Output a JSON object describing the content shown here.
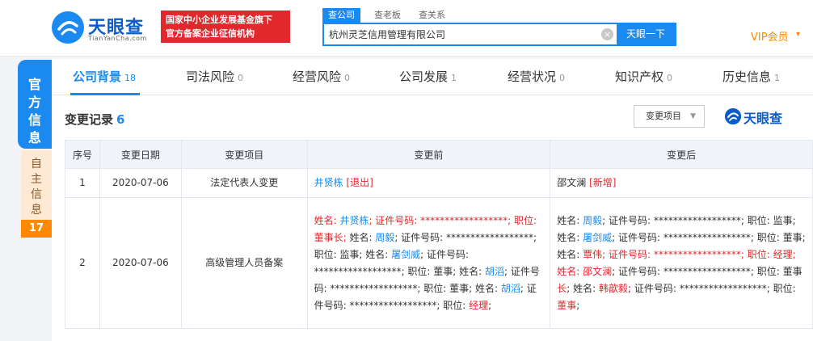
{
  "header": {
    "logo_text": "天眼查",
    "logo_sub": "TianYanCha.com",
    "badge_line1": "国家中小企业发展基金旗下",
    "badge_line2": "官方备案企业征信机构",
    "search_tabs": [
      "查公司",
      "查老板",
      "查关系"
    ],
    "search_value": "杭州灵芝信用管理有限公司",
    "clear_icon": "×",
    "search_button": "天眼一下",
    "vip_label": "VIP会员",
    "vip_arrow": "▾"
  },
  "sidebar": {
    "official_label": "官方信息",
    "self_label": "自主信息",
    "self_count": "17"
  },
  "tabs": [
    {
      "label": "公司背景",
      "count": "18"
    },
    {
      "label": "司法风险",
      "count": "0"
    },
    {
      "label": "经营风险",
      "count": "0"
    },
    {
      "label": "公司发展",
      "count": "1"
    },
    {
      "label": "经营状况",
      "count": "0"
    },
    {
      "label": "知识产权",
      "count": "0"
    },
    {
      "label": "历史信息",
      "count": "1"
    }
  ],
  "section": {
    "title": "变更记录",
    "count": "6",
    "filter_label": "变更项目",
    "filter_caret": "▼",
    "watermark": "天眼查"
  },
  "table": {
    "headers": [
      "序号",
      "变更日期",
      "变更项目",
      "变更前",
      "变更后"
    ],
    "rows": [
      {
        "index": "1",
        "date": "2020-07-06",
        "item": "法定代表人变更",
        "before": [
          {
            "t": "井贤栋",
            "c": "blue"
          },
          {
            "t": " [退出]",
            "c": "red"
          }
        ],
        "after": [
          {
            "t": "邵文澜",
            "c": ""
          },
          {
            "t": " [新增]",
            "c": "red"
          }
        ]
      },
      {
        "index": "2",
        "date": "2020-07-06",
        "item": "高级管理人员备案",
        "before": [
          {
            "t": "姓名: ",
            "c": "red"
          },
          {
            "t": "井贤栋",
            "c": "blue"
          },
          {
            "t": "; 证件号码: ******************; 职位: 董事长; ",
            "c": "red"
          },
          {
            "t": "姓名: ",
            "c": ""
          },
          {
            "t": "周毅",
            "c": "blue"
          },
          {
            "t": "; 证件号码: ******************; 职位: 监事; 姓名: ",
            "c": ""
          },
          {
            "t": "屠剑威",
            "c": "blue"
          },
          {
            "t": "; 证件号码: ******************; 职位: 董事; 姓名: ",
            "c": ""
          },
          {
            "t": "胡滔",
            "c": "blue"
          },
          {
            "t": "; 证件号码: ******************; 职位: 董事; 姓名: ",
            "c": ""
          },
          {
            "t": "胡滔",
            "c": "blue"
          },
          {
            "t": "; 证件号码: ******************; 职位: ",
            "c": ""
          },
          {
            "t": "经理",
            "c": "red"
          },
          {
            "t": ";",
            "c": ""
          }
        ],
        "after": [
          {
            "t": "姓名: ",
            "c": ""
          },
          {
            "t": "周毅",
            "c": "blue"
          },
          {
            "t": "; 证件号码: ******************; 职位: 监事; 姓名: ",
            "c": ""
          },
          {
            "t": "屠剑威",
            "c": "blue"
          },
          {
            "t": "; 证件号码: ******************; 职位: 董事; 姓名: ",
            "c": ""
          },
          {
            "t": "覃伟",
            "c": "red"
          },
          {
            "t": "; 证件号码: ******************; 职位: 经理; 姓名: 邵文澜",
            "c": "red"
          },
          {
            "t": "; 证件号码: ******************; 职位: 董事",
            "c": ""
          },
          {
            "t": "长",
            "c": "red"
          },
          {
            "t": "; 姓名: ",
            "c": ""
          },
          {
            "t": "韩歆毅",
            "c": "red"
          },
          {
            "t": "; 证件号码: ******************; 职位: ",
            "c": ""
          },
          {
            "t": "董事",
            "c": "red"
          },
          {
            "t": ";",
            "c": ""
          }
        ]
      }
    ]
  }
}
